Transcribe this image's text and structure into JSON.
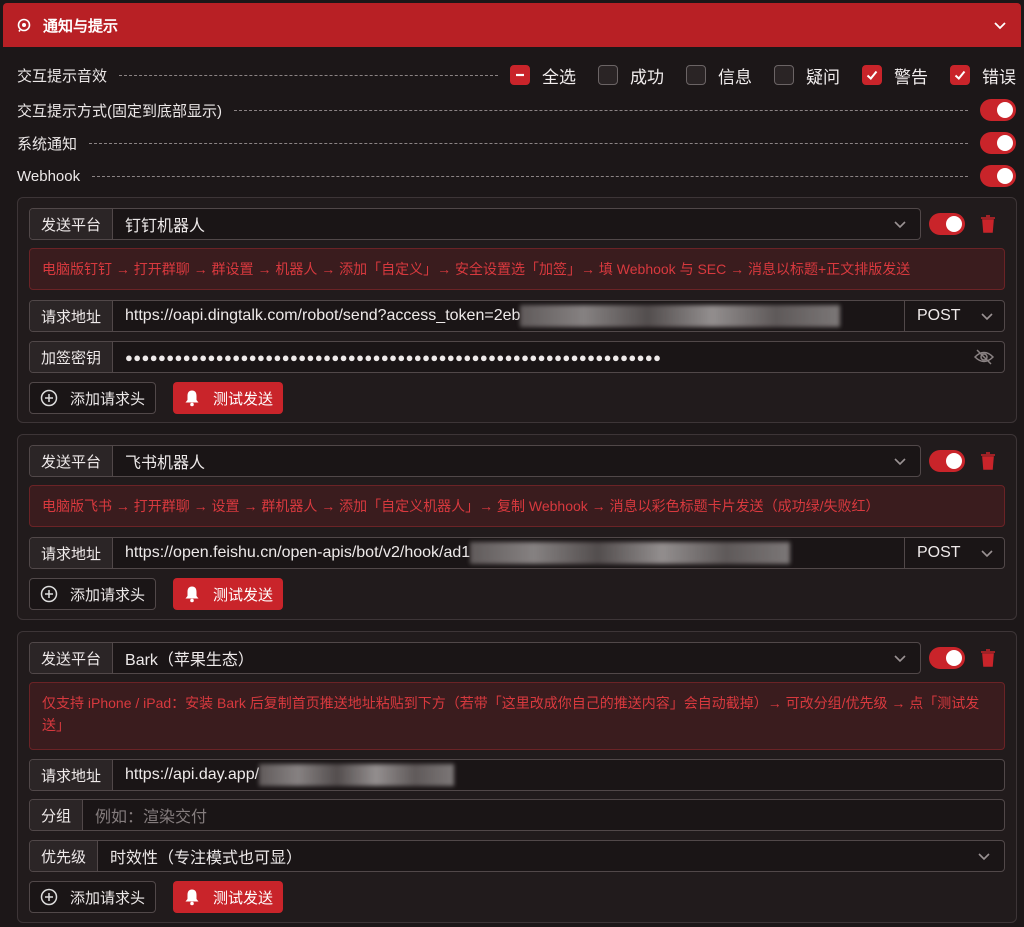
{
  "header": {
    "title": "通知与提示"
  },
  "settings": {
    "sound": {
      "label": "交互提示音效",
      "options": [
        {
          "label": "全选",
          "state": "indeterminate"
        },
        {
          "label": "成功",
          "state": "unchecked"
        },
        {
          "label": "信息",
          "state": "unchecked"
        },
        {
          "label": "疑问",
          "state": "unchecked"
        },
        {
          "label": "警告",
          "state": "checked"
        },
        {
          "label": "错误",
          "state": "checked"
        }
      ]
    },
    "mode": {
      "label": "交互提示方式(固定到底部显示)",
      "on": true
    },
    "system": {
      "label": "系统通知",
      "on": true
    },
    "webhook": {
      "label": "Webhook",
      "on": true
    }
  },
  "cards": [
    {
      "platform_label": "发送平台",
      "platform": "钉钉机器人",
      "hint": "电脑版钉钉 → 打开群聊 → 群设置 → 机器人 → 添加「自定义」→ 安全设置选「加签」→ 填 Webhook 与 SEC → 消息以标题+正文排版发送",
      "url_label": "请求地址",
      "url": "https://oapi.dingtalk.com/robot/send?access_token=2eb",
      "method": "POST",
      "secret_label": "加签密钥",
      "secret": "●●●●●●●●●●●●●●●●●●●●●●●●●●●●●●●●●●●●●●●●●●●●●●●●●●●●●●●●●●●●●●●●●",
      "add_header": "添加请求头",
      "test": "测试发送"
    },
    {
      "platform_label": "发送平台",
      "platform": "飞书机器人",
      "hint": "电脑版飞书 → 打开群聊 → 设置 → 群机器人 → 添加「自定义机器人」→ 复制 Webhook → 消息以彩色标题卡片发送（成功绿/失败红）",
      "url_label": "请求地址",
      "url": "https://open.feishu.cn/open-apis/bot/v2/hook/ad1",
      "method": "POST",
      "add_header": "添加请求头",
      "test": "测试发送"
    },
    {
      "platform_label": "发送平台",
      "platform": "Bark（苹果生态）",
      "hint": "仅支持 iPhone / iPad：安装 Bark 后复制首页推送地址粘贴到下方（若带「这里改成你自己的推送内容」会自动截掉）→ 可改分组/优先级 → 点「测试发送」",
      "url_label": "请求地址",
      "url": "https://api.day.app/",
      "group_label": "分组",
      "group_placeholder": "例如：渲染交付",
      "priority_label": "优先级",
      "priority": "时效性（专注模式也可显）",
      "add_header": "添加请求头",
      "test": "测试发送"
    }
  ],
  "colors": {
    "accent": "#c9242a",
    "background": "#1c1718",
    "hint_text": "#d8393e"
  }
}
